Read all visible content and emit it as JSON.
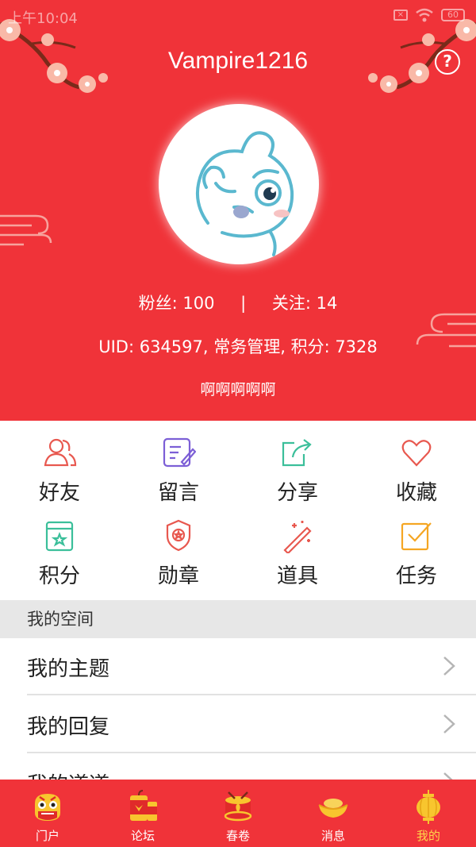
{
  "status_bar": {
    "time": "上午10:04",
    "battery": "60"
  },
  "profile": {
    "username": "Vampire1216",
    "help_icon": "?",
    "followers_label": "粉丝: 100",
    "separator": "|",
    "following_label": "关注: 14",
    "uid_line": "UID: 634597, 常务管理, 积分: 7328",
    "signature": "啊啊啊啊啊"
  },
  "features": [
    {
      "label": "好友",
      "icon": "friends-icon",
      "color": "#e8584f"
    },
    {
      "label": "留言",
      "icon": "message-icon",
      "color": "#7c5fd6"
    },
    {
      "label": "分享",
      "icon": "share-icon",
      "color": "#3bbf9a"
    },
    {
      "label": "收藏",
      "icon": "heart-icon",
      "color": "#e8584f"
    },
    {
      "label": "积分",
      "icon": "points-icon",
      "color": "#3bbf9a"
    },
    {
      "label": "勋章",
      "icon": "medal-icon",
      "color": "#e8584f"
    },
    {
      "label": "道具",
      "icon": "wand-icon",
      "color": "#e8584f"
    },
    {
      "label": "任务",
      "icon": "task-icon",
      "color": "#f5a623"
    }
  ],
  "section_title": "我的空间",
  "list": [
    {
      "label": "我的主题"
    },
    {
      "label": "我的回复"
    },
    {
      "label": "我的道道"
    }
  ],
  "tabs": [
    {
      "label": "门户",
      "icon": "lion-dance-icon"
    },
    {
      "label": "论坛",
      "icon": "firecracker-icon"
    },
    {
      "label": "春卷",
      "icon": "drum-icon"
    },
    {
      "label": "消息",
      "icon": "gold-ingot-icon"
    },
    {
      "label": "我的",
      "icon": "lantern-icon",
      "active": true
    }
  ],
  "colors": {
    "brand_red": "#f03339",
    "active_tab": "#ffd54a"
  }
}
